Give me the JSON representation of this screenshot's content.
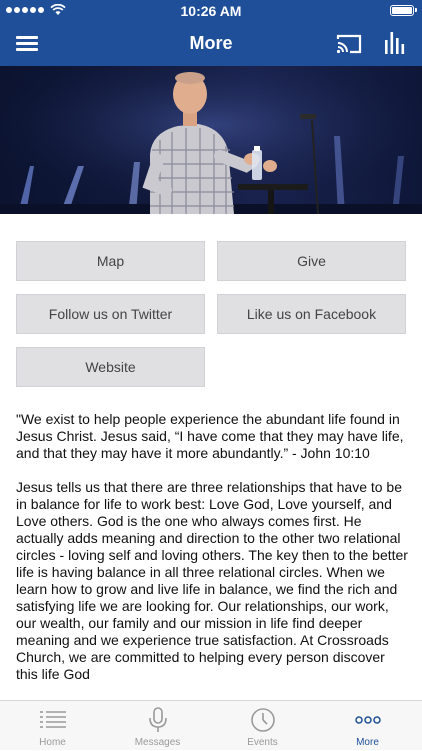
{
  "status_bar": {
    "time": "10:26 AM"
  },
  "header": {
    "title": "More",
    "menu_icon": "hamburger-menu-icon",
    "cast_icon": "cast-icon",
    "stats_icon": "audio-bars-icon"
  },
  "hero": {
    "image": "pastor-speaking-on-stage"
  },
  "buttons": {
    "map": "Map",
    "give": "Give",
    "twitter": "Follow us on Twitter",
    "facebook": "Like us on Facebook",
    "website": "Website"
  },
  "body": {
    "paragraph1": "\"We exist to help people experience the abundant life found in Jesus Christ. Jesus said, “I have come that they may have life, and that they may have it more abundantly.” - John 10:10",
    "paragraph2": "Jesus tells us that there are three relationships that have to be in balance for life to work best: Love God, Love yourself, and Love others. God is the one who always comes first. He actually adds meaning and direction to the other two relational circles - loving self and loving others. The key then to the better life is having balance in all three relational circles. When we learn how to grow and live life in balance, we find the rich and satisfying life we are looking for. Our relationships, our work, our wealth, our family and our mission in life find deeper meaning and we experience true satisfaction. At Crossroads Church, we are committed to helping every person discover this life God"
  },
  "tabs": [
    {
      "label": "Home",
      "icon": "list-icon"
    },
    {
      "label": "Messages",
      "icon": "microphone-icon"
    },
    {
      "label": "Events",
      "icon": "clock-icon"
    },
    {
      "label": "More",
      "icon": "more-dots-icon"
    }
  ],
  "colors": {
    "brand_blue": "#1f4f98",
    "button_gray": "#e0e0e2",
    "tab_inactive": "#9a9a9a"
  }
}
